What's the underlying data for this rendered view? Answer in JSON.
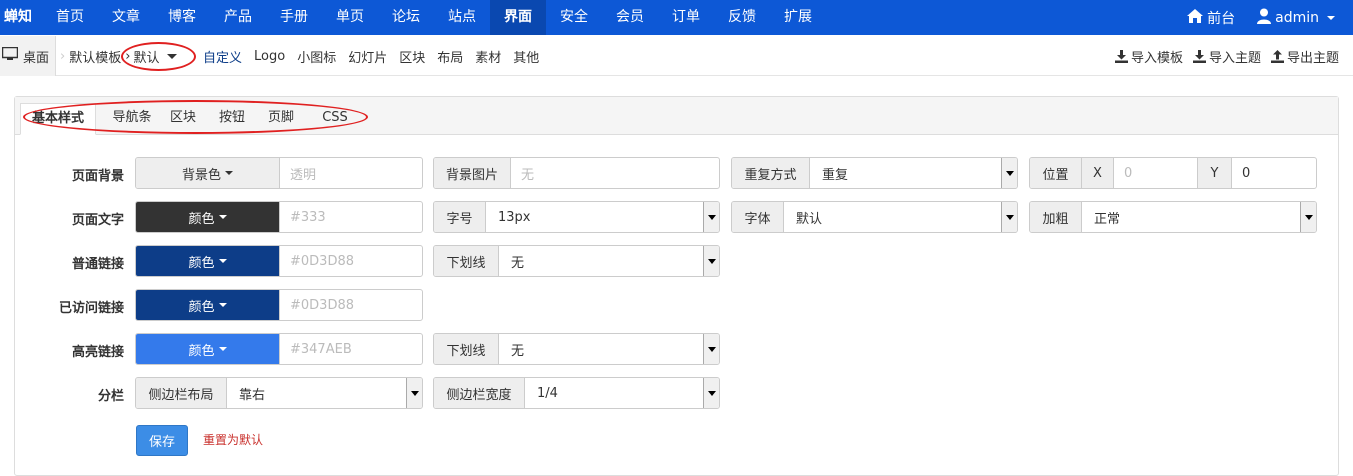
{
  "nav": {
    "brand": "蝉知",
    "items": [
      "首页",
      "文章",
      "博客",
      "产品",
      "手册",
      "单页",
      "论坛",
      "站点",
      "界面",
      "安全",
      "会员",
      "订单",
      "反馈",
      "扩展"
    ],
    "active_index": 8,
    "front_label": "前台",
    "user_label": "admin"
  },
  "breadcrumb": {
    "desktop": "桌面",
    "template": "默认模板",
    "theme": "默认"
  },
  "subnav": [
    "自定义",
    "Logo",
    "小图标",
    "幻灯片",
    "区块",
    "布局",
    "素材",
    "其他"
  ],
  "actions": [
    "导入模板",
    "导入主题",
    "导出主题"
  ],
  "tabs": [
    "基本样式",
    "导航条",
    "区块",
    "按钮",
    "页脚",
    "CSS"
  ],
  "form": {
    "bg_label": "页面背景",
    "bg_color_btn": "背景色",
    "bg_color_placeholder": "透明",
    "bg_image_addon": "背景图片",
    "bg_image_placeholder": "无",
    "repeat_addon": "重复方式",
    "repeat_value": "重复",
    "pos_addon": "位置",
    "pos_x_addon": "X",
    "pos_x_placeholder": "0",
    "pos_y_addon": "Y",
    "pos_y_value": "0",
    "text_label": "页面文字",
    "color_btn": "颜色",
    "text_color_placeholder": "#333",
    "fontsize_addon": "字号",
    "fontsize_value": "13px",
    "font_addon": "字体",
    "font_value": "默认",
    "bold_addon": "加粗",
    "bold_value": "正常",
    "link_label": "普通链接",
    "link_color_placeholder": "#0D3D88",
    "underline_addon": "下划线",
    "link_underline_value": "无",
    "visited_label": "已访问链接",
    "visited_color_placeholder": "#0D3D88",
    "hover_label": "高亮链接",
    "hover_color_placeholder": "#347AEB",
    "hover_underline_value": "无",
    "column_label": "分栏",
    "sidebar_layout_addon": "侧边栏布局",
    "sidebar_layout_value": "靠右",
    "sidebar_width_addon": "侧边栏宽度",
    "sidebar_width_value": "1/4",
    "save": "保存",
    "reset": "重置为默认"
  },
  "colors": {
    "nav_bg": "#0d58d6",
    "text_swatch": "#333333",
    "link_swatch": "#0d3d88",
    "visited_swatch": "#0d3d88",
    "hover_swatch": "#347aeb"
  }
}
